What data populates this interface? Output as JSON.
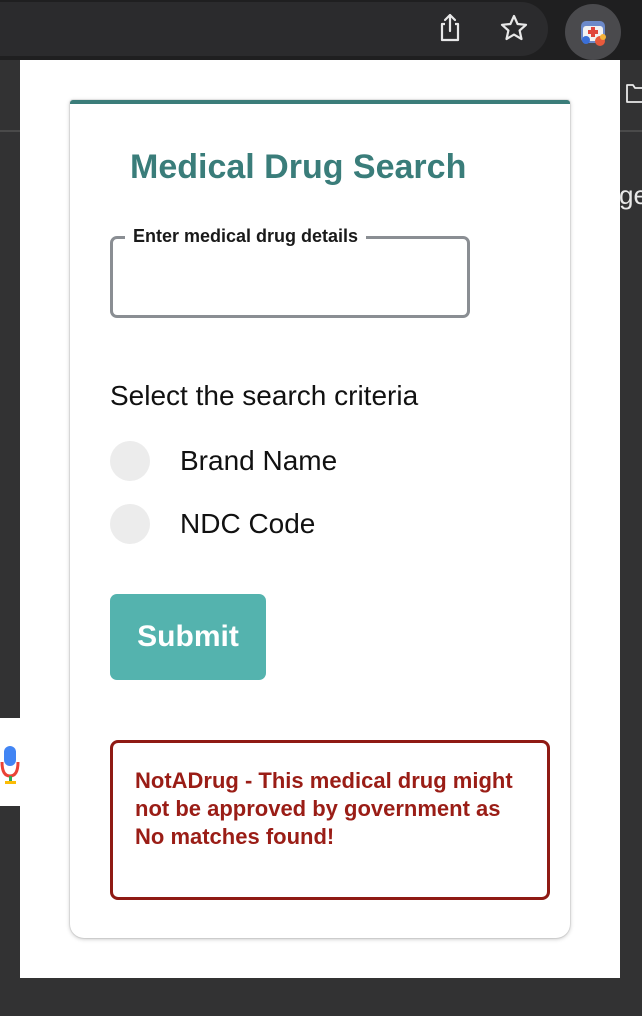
{
  "browser": {
    "toolbar_icons": [
      "share-icon",
      "star-icon",
      "extension-icon"
    ],
    "background_page_fragment": "ge"
  },
  "popup": {
    "title": "Medical Drug Search",
    "input": {
      "legend": "Enter medical drug details",
      "value": "",
      "placeholder": ""
    },
    "criteria_label": "Select the search criteria",
    "options": [
      {
        "label": "Brand Name",
        "selected": false
      },
      {
        "label": "NDC Code",
        "selected": false
      }
    ],
    "submit_label": "Submit",
    "result_message": "NotADrug - This medical drug might not be approved by government as No matches found!"
  },
  "colors": {
    "title": "#3a7d7a",
    "card_top_border": "#3b7d7a",
    "submit_button": "#54b3ae",
    "alert": "#9a1d16"
  }
}
